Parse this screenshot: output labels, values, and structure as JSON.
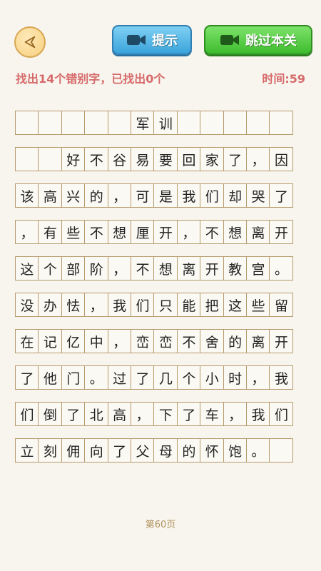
{
  "header": {
    "hint_label": "提示",
    "skip_label": "跳过本关"
  },
  "status": {
    "task_text": "找出14个错别字，已找出0个",
    "timer_text": "时间:59"
  },
  "grid_rows": [
    [
      "",
      "",
      "",
      "",
      "",
      "军",
      "训",
      "",
      "",
      "",
      "",
      ""
    ],
    [
      "",
      "",
      "好",
      "不",
      "谷",
      "易",
      "要",
      "回",
      "家",
      "了",
      "，",
      "因"
    ],
    [
      "该",
      "高",
      "兴",
      "的",
      "，",
      "可",
      "是",
      "我",
      "们",
      "却",
      "哭",
      "了"
    ],
    [
      "，",
      "有",
      "些",
      "不",
      "想",
      "厘",
      "开",
      "，",
      "不",
      "想",
      "离",
      "开"
    ],
    [
      "这",
      "个",
      "部",
      "阶",
      "，",
      "不",
      "想",
      "离",
      "开",
      "教",
      "宫",
      "。"
    ],
    [
      "没",
      "办",
      "怯",
      "，",
      "我",
      "们",
      "只",
      "能",
      "把",
      "这",
      "些",
      "留"
    ],
    [
      "在",
      "记",
      "亿",
      "中",
      "，",
      "峦",
      "峦",
      "不",
      "舍",
      "的",
      "离",
      "开"
    ],
    [
      "了",
      "他",
      "门",
      "。",
      "过",
      "了",
      "几",
      "个",
      "小",
      "时",
      "，",
      "我"
    ],
    [
      "们",
      "倒",
      "了",
      "北",
      "高",
      "，",
      "下",
      "了",
      "车",
      "，",
      "我",
      "们"
    ],
    [
      "立",
      "刻",
      "佣",
      "向",
      "了",
      "父",
      "母",
      "的",
      "怀",
      "饱",
      "。",
      ""
    ]
  ],
  "footer": {
    "page_text": "第60页"
  },
  "icons": {
    "back": "back-arrow-icon",
    "video": "video-camera-icon"
  },
  "colors": {
    "accent_red": "#d66a6a",
    "hint_blue": "#3aa3db",
    "skip_green": "#3ebb2e",
    "grid_border": "#b59a6c"
  }
}
